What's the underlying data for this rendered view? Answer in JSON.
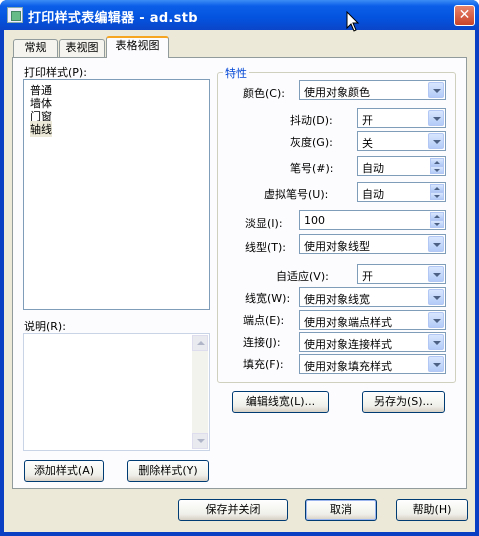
{
  "window": {
    "title": "打印样式表编辑器 - ad.stb",
    "close_glyph": "✕"
  },
  "tabs": [
    {
      "label": "常规"
    },
    {
      "label": "表视图"
    },
    {
      "label": "表格视图",
      "active": true
    }
  ],
  "styles_list": {
    "label": "打印样式(P):",
    "items": [
      "普通",
      "墙体",
      "门窗",
      "轴线"
    ],
    "selected": "轴线"
  },
  "description": {
    "label": "说明(R):",
    "value": ""
  },
  "left_buttons": {
    "add": "添加样式(A)",
    "delete": "删除样式(Y)"
  },
  "properties": {
    "group_label": "特性",
    "color": {
      "label": "颜色(C):",
      "value": "使用对象颜色"
    },
    "dither": {
      "label": "抖动(D):",
      "value": "开"
    },
    "grayscale": {
      "label": "灰度(G):",
      "value": "关"
    },
    "pen": {
      "label": "笔号(#):",
      "value": "自动"
    },
    "virtual_pen": {
      "label": "虚拟笔号(U):",
      "value": "自动"
    },
    "screening": {
      "label": "淡显(I):",
      "value": "100"
    },
    "linetype": {
      "label": "线型(T):",
      "value": "使用对象线型"
    },
    "adaptive": {
      "label": "自适应(V):",
      "value": "开"
    },
    "lineweight": {
      "label": "线宽(W):",
      "value": "使用对象线宽"
    },
    "endstyle": {
      "label": "端点(E):",
      "value": "使用对象端点样式"
    },
    "joinstyle": {
      "label": "连接(J):",
      "value": "使用对象连接样式"
    },
    "fillstyle": {
      "label": "填充(F):",
      "value": "使用对象填充样式"
    },
    "edit_lineweights": "编辑线宽(L)...",
    "save_as": "另存为(S)..."
  },
  "footer": {
    "save_close": "保存并关闭",
    "cancel": "取消",
    "help": "帮助(H)"
  },
  "colors": {
    "title_bar": "#0453df",
    "dialog_bg": "#ece9d8",
    "group_label": "#0046d5"
  }
}
